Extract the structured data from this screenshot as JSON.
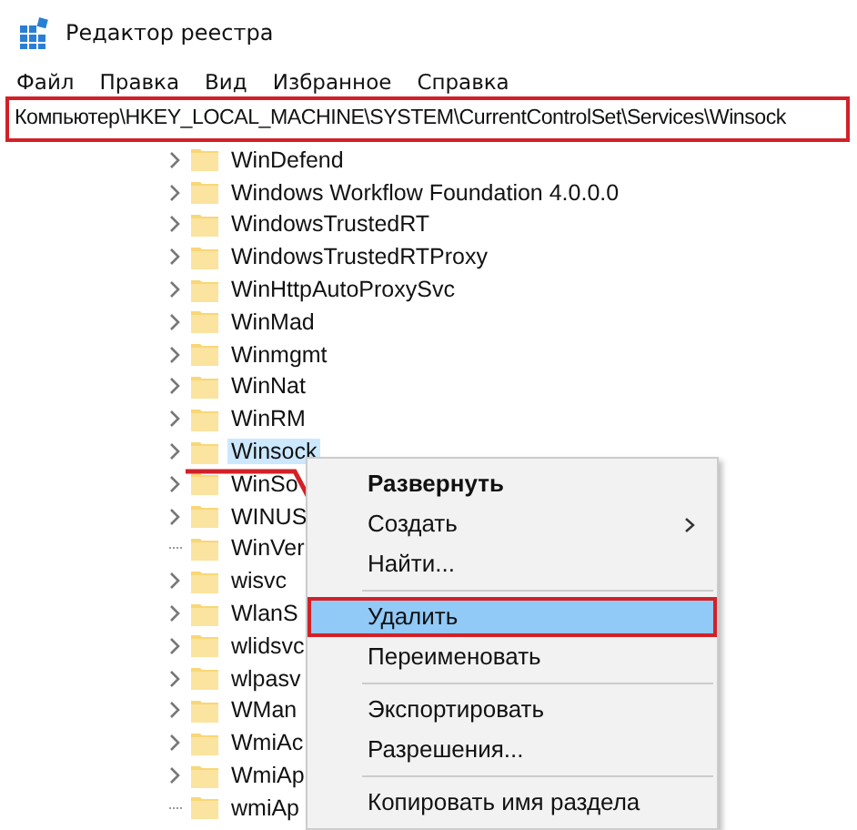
{
  "window": {
    "title": "Редактор реестра"
  },
  "menu_bar": [
    "Файл",
    "Правка",
    "Вид",
    "Избранное",
    "Справка"
  ],
  "address_bar": {
    "value": "Компьютер\\HKEY_LOCAL_MACHINE\\SYSTEM\\CurrentControlSet\\Services\\Winsock",
    "highlighted": true
  },
  "tree": [
    {
      "label": "WinDefend",
      "has_children": true,
      "selected": false
    },
    {
      "label": "Windows Workflow Foundation 4.0.0.0",
      "has_children": true,
      "selected": false
    },
    {
      "label": "WindowsTrustedRT",
      "has_children": true,
      "selected": false
    },
    {
      "label": "WindowsTrustedRTProxy",
      "has_children": true,
      "selected": false
    },
    {
      "label": "WinHttpAutoProxySvc",
      "has_children": true,
      "selected": false
    },
    {
      "label": "WinMad",
      "has_children": true,
      "selected": false
    },
    {
      "label": "Winmgmt",
      "has_children": true,
      "selected": false
    },
    {
      "label": "WinNat",
      "has_children": true,
      "selected": false
    },
    {
      "label": "WinRM",
      "has_children": true,
      "selected": false
    },
    {
      "label": "Winsock",
      "has_children": true,
      "selected": true
    },
    {
      "label": "WinSo",
      "has_children": true,
      "selected": false
    },
    {
      "label": "WINUS",
      "has_children": true,
      "selected": false
    },
    {
      "label": "WinVer",
      "has_children": false,
      "selected": false
    },
    {
      "label": "wisvc",
      "has_children": true,
      "selected": false
    },
    {
      "label": "WlanS",
      "has_children": true,
      "selected": false
    },
    {
      "label": "wlidsvc",
      "has_children": true,
      "selected": false
    },
    {
      "label": "wlpasv",
      "has_children": true,
      "selected": false
    },
    {
      "label": "WMan",
      "has_children": true,
      "selected": false
    },
    {
      "label": "WmiAc",
      "has_children": true,
      "selected": false
    },
    {
      "label": "WmiAp",
      "has_children": true,
      "selected": false
    },
    {
      "label": "wmiAp",
      "has_children": false,
      "selected": false
    }
  ],
  "context_menu": [
    {
      "kind": "item",
      "label": "Развернуть",
      "bold": true,
      "submenu": false,
      "selected": false,
      "highlighted": false
    },
    {
      "kind": "item",
      "label": "Создать",
      "bold": false,
      "submenu": true,
      "selected": false,
      "highlighted": false
    },
    {
      "kind": "item",
      "label": "Найти...",
      "bold": false,
      "submenu": false,
      "selected": false,
      "highlighted": false
    },
    {
      "kind": "separator"
    },
    {
      "kind": "item",
      "label": "Удалить",
      "bold": false,
      "submenu": false,
      "selected": true,
      "highlighted": true
    },
    {
      "kind": "item",
      "label": "Переименовать",
      "bold": false,
      "submenu": false,
      "selected": false,
      "highlighted": false
    },
    {
      "kind": "separator"
    },
    {
      "kind": "item",
      "label": "Экспортировать",
      "bold": false,
      "submenu": false,
      "selected": false,
      "highlighted": false
    },
    {
      "kind": "item",
      "label": "Разрешения...",
      "bold": false,
      "submenu": false,
      "selected": false,
      "highlighted": false
    },
    {
      "kind": "separator"
    },
    {
      "kind": "item",
      "label": "Копировать имя раздела",
      "bold": false,
      "submenu": false,
      "selected": false,
      "highlighted": false
    }
  ]
}
